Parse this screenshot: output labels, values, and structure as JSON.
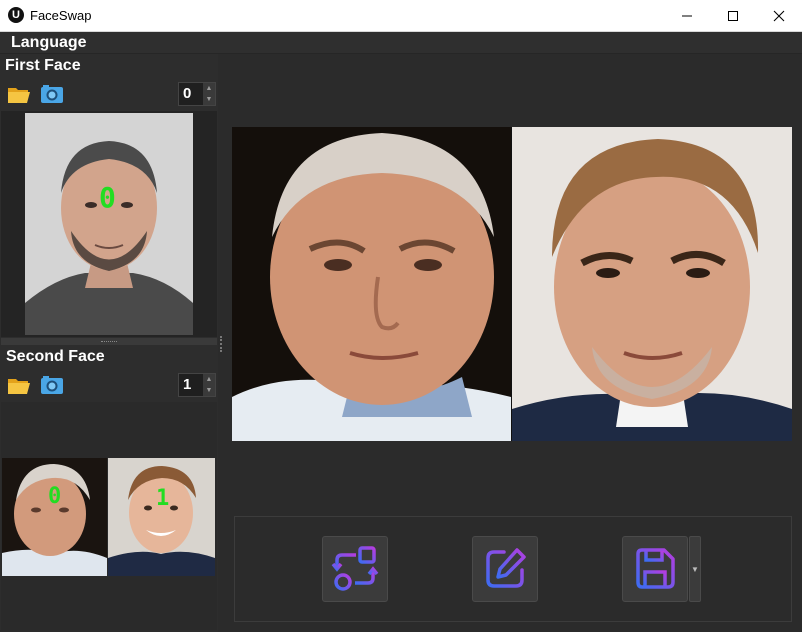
{
  "window": {
    "title": "FaceSwap",
    "controls": [
      "minimize-icon",
      "maximize-icon",
      "close-icon"
    ]
  },
  "menu": {
    "items": [
      {
        "label": "Language"
      }
    ]
  },
  "first_face": {
    "label": "First Face",
    "open_icon": "folder-icon",
    "camera_icon": "camera-icon",
    "index_value": "0",
    "face_tag": "0"
  },
  "second_face": {
    "label": "Second Face",
    "open_icon": "folder-icon",
    "camera_icon": "camera-icon",
    "index_value": "1",
    "thumb_tags": [
      "0",
      "1"
    ]
  },
  "toolbar": {
    "swap_icon": "swap-icon",
    "edit_icon": "edit-icon",
    "save_icon": "save-icon",
    "accent_gradient": [
      "#3d6cf2",
      "#b43de0"
    ]
  }
}
